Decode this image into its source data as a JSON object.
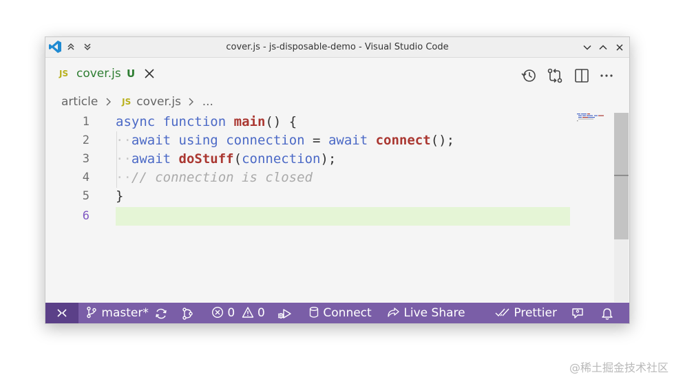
{
  "window": {
    "title": "cover.js - js-disposable-demo - Visual Studio Code"
  },
  "tab": {
    "lang_badge": "JS",
    "name": "cover.js",
    "status": "U"
  },
  "breadcrumb": {
    "folder": "article",
    "lang_badge": "JS",
    "file": "cover.js",
    "more": "..."
  },
  "editor": {
    "line_numbers": [
      "1",
      "2",
      "3",
      "4",
      "5",
      "6"
    ],
    "active_line": "6",
    "lines": [
      [
        "async",
        "function",
        "main",
        "() {"
      ],
      [
        "··",
        "await",
        "using",
        "connection",
        "=",
        "await",
        "connect",
        "();"
      ],
      [
        "··",
        "await",
        "doStuff",
        "(",
        "connection",
        ");"
      ],
      [
        "··",
        "// connection is closed"
      ],
      [
        "}"
      ]
    ]
  },
  "statusbar": {
    "branch": "master*",
    "errors": "0",
    "warnings": "0",
    "connect": "Connect",
    "live_share": "Live Share",
    "prettier": "Prettier"
  },
  "colors": {
    "statusbar": "#7a5ea7",
    "remote": "#5b4088",
    "keyword": "#4b69c6",
    "function": "#aa3731",
    "comment": "#aaaaaa",
    "highlight_line": "#e5f5d6"
  },
  "icons": [
    "vscode-logo-icon",
    "chevron-up-double-icon",
    "chevron-down-double-icon",
    "chevron-down-icon",
    "chevron-up-icon",
    "close-icon",
    "history-icon",
    "compare-changes-icon",
    "split-editor-icon",
    "more-icon",
    "remote-icon",
    "git-branch-icon",
    "sync-icon",
    "git-graph-icon",
    "error-icon",
    "warning-icon",
    "debug-run-icon",
    "database-icon",
    "live-share-icon",
    "check-all-icon",
    "feedback-icon",
    "bell-icon"
  ],
  "watermark": "@稀土掘金技术社区"
}
